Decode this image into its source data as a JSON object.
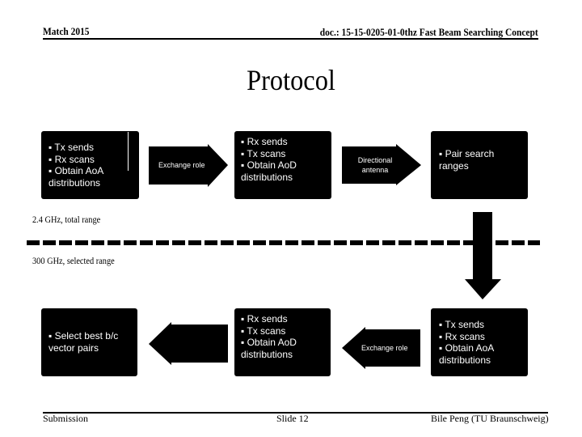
{
  "header": {
    "date": "Match 2015",
    "doc": "doc.: 15-15-0205-01-0thz Fast Beam Searching Concept"
  },
  "title": "Protocol",
  "top_row": {
    "box1": {
      "lines": [
        "▪ Tx sends",
        "▪ Rx scans",
        "▪ Obtain  AoA",
        "distributions"
      ]
    },
    "arrow1": {
      "label": "Exchange role",
      "direction": "right"
    },
    "box2": {
      "lines": [
        "▪ Rx sends",
        "▪ Tx scans",
        "▪ Obtain  AoD",
        "distributions"
      ]
    },
    "arrow2": {
      "label_line1": "Directional",
      "label_line2": "antenna",
      "direction": "right"
    },
    "box3": {
      "lines": [
        "▪ Pair search",
        "ranges"
      ]
    }
  },
  "divider": {
    "upper_label": "2.4 GHz, total range",
    "lower_label": "300 GHz, selected range"
  },
  "down_arrow": {
    "direction": "down"
  },
  "bottom_row": {
    "box1": {
      "lines": [
        "▪ Select best b/c",
        "vector pairs"
      ]
    },
    "arrow1": {
      "direction": "left"
    },
    "box2": {
      "lines": [
        "▪ Rx sends",
        "▪ Tx scans",
        "▪  Obtain  AoD",
        "distributions"
      ]
    },
    "arrow2": {
      "label": "Exchange role",
      "direction": "left"
    },
    "box3": {
      "lines": [
        "▪ Tx sends",
        "▪ Rx scans",
        "▪  Obtain  AoA",
        "distributions"
      ]
    }
  },
  "footer": {
    "left": "Submission",
    "center": "Slide 12",
    "right": "Bile Peng (TU Braunschweig)"
  }
}
